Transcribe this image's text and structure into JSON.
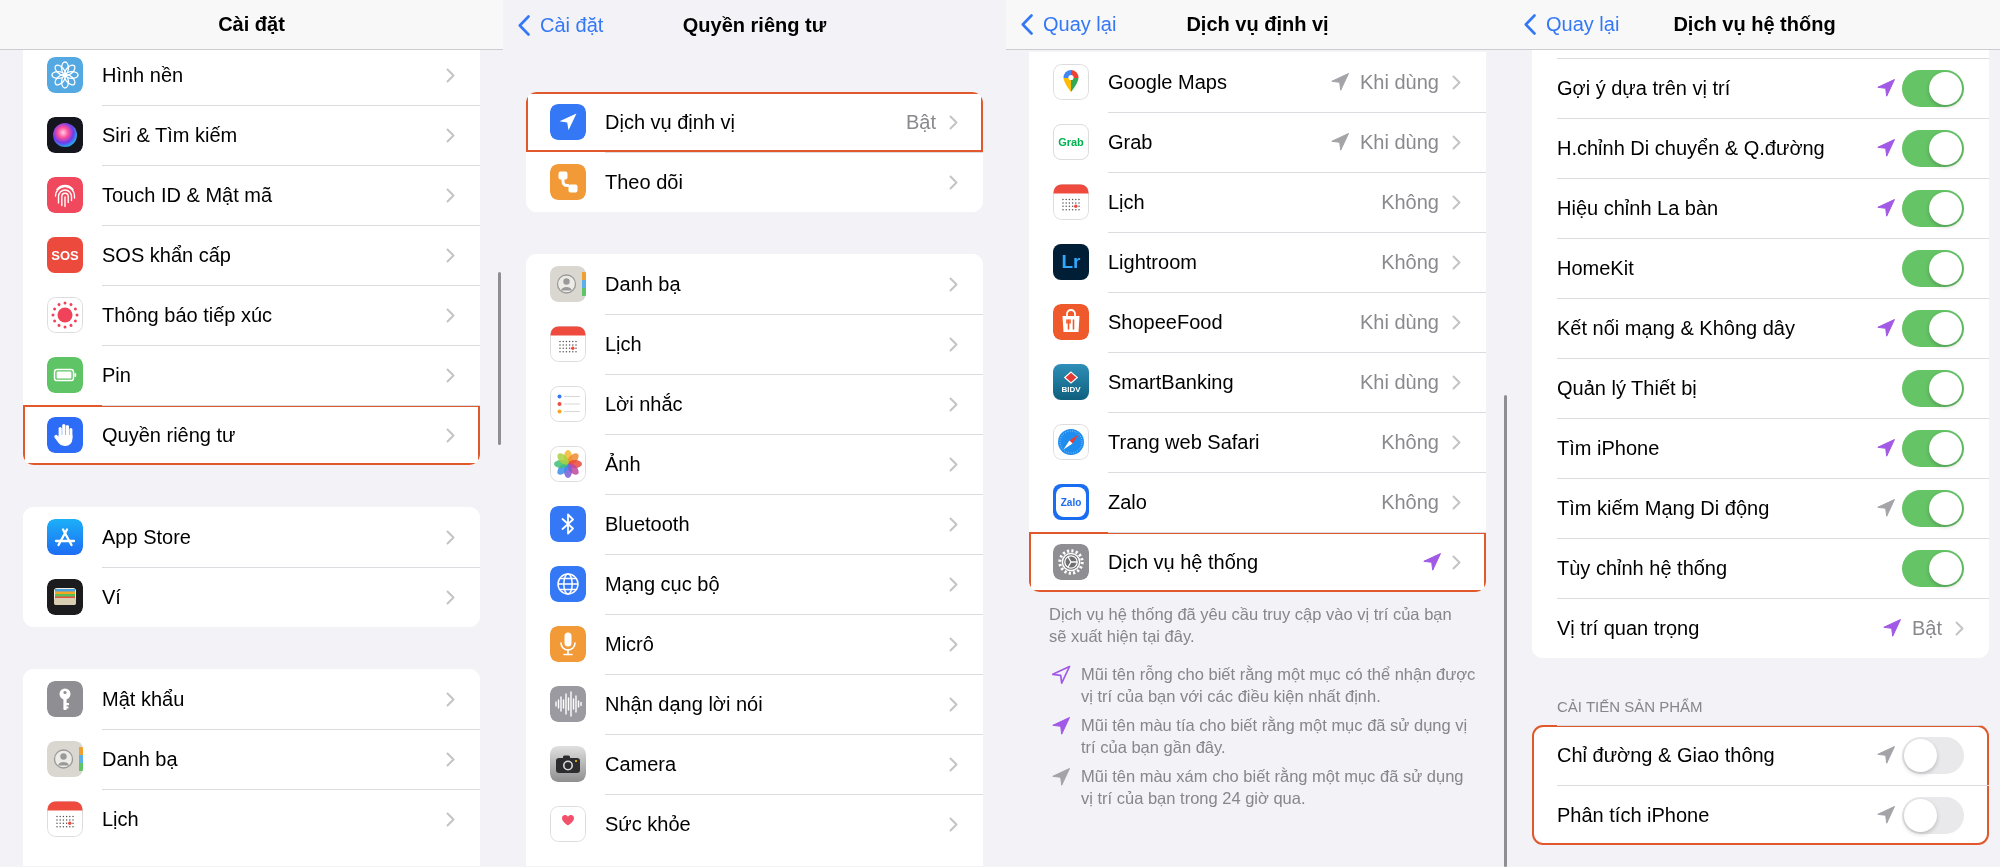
{
  "screens": [
    {
      "nav": {
        "title": "Cài đặt",
        "scrolled": true
      },
      "sections": [
        {
          "rows": [
            {
              "label": "Hình nền",
              "highlighted": false
            },
            {
              "label": "Siri & Tìm kiếm",
              "highlighted": false
            },
            {
              "label": "Touch ID & Mật mã",
              "highlighted": false
            },
            {
              "label": "SOS khẩn cấp",
              "icon_text": "SOS",
              "highlighted": false
            },
            {
              "label": "Thông báo tiếp xúc",
              "highlighted": false
            },
            {
              "label": "Pin",
              "highlighted": false
            },
            {
              "label": "Quyền riêng tư",
              "highlighted": true
            }
          ]
        },
        {
          "rows": [
            {
              "label": "App Store",
              "highlighted": false
            },
            {
              "label": "Ví",
              "highlighted": false
            }
          ]
        },
        {
          "rows": [
            {
              "label": "Mật khẩu",
              "highlighted": false
            },
            {
              "label": "Danh bạ",
              "highlighted": false
            },
            {
              "label": "Lịch",
              "highlighted": false
            }
          ]
        }
      ]
    },
    {
      "nav": {
        "back": "Cài đặt",
        "title": "Quyền riêng tư",
        "scrolled": false
      },
      "sections": [
        {
          "rows": [
            {
              "label": "Dịch vụ định vị",
              "value": "Bật",
              "highlighted": true
            },
            {
              "label": "Theo dõi",
              "highlighted": false
            }
          ]
        },
        {
          "rows": [
            {
              "label": "Danh bạ",
              "highlighted": false
            },
            {
              "label": "Lịch",
              "highlighted": false
            },
            {
              "label": "Lời nhắc",
              "highlighted": false
            },
            {
              "label": "Ảnh",
              "highlighted": false
            },
            {
              "label": "Bluetooth",
              "highlighted": false
            },
            {
              "label": "Mạng cục bộ",
              "highlighted": false
            },
            {
              "label": "Micrô",
              "highlighted": false
            },
            {
              "label": "Nhận dạng lời nói",
              "highlighted": false
            },
            {
              "label": "Camera",
              "highlighted": false
            },
            {
              "label": "Sức khỏe",
              "highlighted": false
            }
          ]
        }
      ]
    },
    {
      "nav": {
        "back": "Quay lại",
        "title": "Dịch vụ định vị",
        "scrolled": true
      },
      "sections": [
        {
          "rows": [
            {
              "label": "Google Maps",
              "arrow": {
                "kind": "filled",
                "color": "#a3a3a8"
              },
              "value": "Khi dùng",
              "highlighted": false
            },
            {
              "label": "Grab",
              "icon_text": "Grab",
              "arrow": {
                "kind": "filled",
                "color": "#a3a3a8"
              },
              "value": "Khi dùng",
              "highlighted": false
            },
            {
              "label": "Lịch",
              "value": "Không",
              "highlighted": false
            },
            {
              "label": "Lightroom",
              "icon_text": "Lr",
              "value": "Không",
              "highlighted": false
            },
            {
              "label": "ShopeeFood",
              "value": "Khi dùng",
              "highlighted": false
            },
            {
              "label": "SmartBanking",
              "icon_text": "BIDV",
              "value": "Khi dùng",
              "highlighted": false
            },
            {
              "label": "Trang web Safari",
              "value": "Không",
              "highlighted": false
            },
            {
              "label": "Zalo",
              "icon_text": "Zalo",
              "value": "Không",
              "highlighted": false
            },
            {
              "label": "Dịch vụ hệ thống",
              "arrow": {
                "kind": "filled",
                "color": "#a259e6"
              },
              "highlighted": true
            }
          ]
        }
      ],
      "footer": "Dịch vụ hệ thống đã yêu cầu truy cập vào vị trí của bạn sẽ xuất hiện tại đây.",
      "legend": [
        {
          "arrow": {
            "kind": "hollow",
            "color": "#a259e6"
          },
          "text": "Mũi tên rỗng cho biết rằng một mục có thể nhận được vị trí của bạn với các điều kiện nhất định."
        },
        {
          "arrow": {
            "kind": "filled",
            "color": "#a259e6"
          },
          "text": "Mũi tên màu tía cho biết rằng một mục đã sử dụng vị trí của bạn gần đây."
        },
        {
          "arrow": {
            "kind": "filled",
            "color": "#a3a3a8"
          },
          "text": "Mũi tên màu xám cho biết rằng một mục đã sử dụng vị trí của bạn trong 24 giờ qua."
        }
      ]
    },
    {
      "nav": {
        "back": "Quay lại",
        "title": "Dịch vụ hệ thống",
        "scrolled": true
      },
      "sections": [
        {
          "highlighted": false,
          "rows": [
            {
              "kind": "toggle",
              "label": "Gợi ý dựa trên vị trí",
              "arrow": {
                "kind": "filled",
                "color": "#a259e6"
              },
              "on": true
            },
            {
              "kind": "toggle",
              "label": "H.chỉnh Di chuyển & Q.đường",
              "arrow": {
                "kind": "filled",
                "color": "#a259e6"
              },
              "on": true
            },
            {
              "kind": "toggle",
              "label": "Hiệu chỉnh La bàn",
              "arrow": {
                "kind": "filled",
                "color": "#a259e6"
              },
              "on": true
            },
            {
              "kind": "toggle",
              "label": "HomeKit",
              "on": true
            },
            {
              "kind": "toggle",
              "label": "Kết nối mạng & Không dây",
              "arrow": {
                "kind": "filled",
                "color": "#a259e6"
              },
              "on": true
            },
            {
              "kind": "toggle",
              "label": "Quản lý Thiết bị",
              "on": true
            },
            {
              "kind": "toggle",
              "label": "Tìm iPhone",
              "arrow": {
                "kind": "filled",
                "color": "#a259e6"
              },
              "on": true
            },
            {
              "kind": "toggle",
              "label": "Tìm kiếm Mạng Di động",
              "arrow": {
                "kind": "filled",
                "color": "#a3a3a8"
              },
              "on": true
            },
            {
              "kind": "toggle",
              "label": "Tùy chỉnh hệ thống",
              "on": true
            },
            {
              "kind": "link",
              "label": "Vị trí quan trọng",
              "arrow": {
                "kind": "filled",
                "color": "#a259e6"
              },
              "value": "Bật"
            }
          ]
        },
        {
          "header": "CẢI TIẾN SẢN PHẨM",
          "highlighted": true,
          "rows": [
            {
              "kind": "toggle",
              "label": "Chỉ đường & Giao thông",
              "arrow": {
                "kind": "filled",
                "color": "#a3a3a8"
              },
              "on": false
            },
            {
              "kind": "toggle",
              "label": "Phân tích iPhone",
              "arrow": {
                "kind": "filled",
                "color": "#a3a3a8"
              },
              "on": false
            }
          ]
        }
      ]
    }
  ]
}
